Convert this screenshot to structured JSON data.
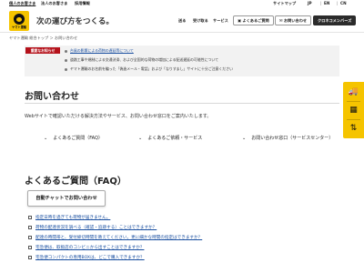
{
  "topbar": {
    "left": [
      "個人のお客さま",
      "法人のお客さま",
      "採用情報"
    ],
    "sitemap": "サイトマップ",
    "languages": [
      "JP",
      "EN",
      "CN"
    ]
  },
  "header": {
    "brand_small": "ヤマト運輸",
    "tagline": "次の運び方をつくる。",
    "nav": [
      "送る",
      "受け取る",
      "サービス"
    ],
    "faq_button": "よくあるご質問",
    "contact_button": "お問い合わせ",
    "member_button": "クロネコメンバーズ"
  },
  "breadcrumb": "ヤマト運輸 総合トップ ＞ お問い合わせ",
  "alert": {
    "badge": "重要なお知らせ",
    "items": [
      {
        "text": "台風の影響による荷物の遅延等について",
        "link": true
      },
      {
        "text": "道路工事や規制による交通渋滞、および全国的な荷物の増加による配送遅延の可能性について",
        "link": false
      },
      {
        "text": "ヤマト運輸のお名前を騙った「偽造メール・電話」および「なりすまし」サイトに十分ご注意ください",
        "link": false
      }
    ]
  },
  "page_title": "お問い合わせ",
  "lead": "Webサイトで確認いただける解決方法やサービス、お問い合わせ窓口をご案内いたします。",
  "anchors": [
    "よくあるご質問（FAQ）",
    "よくあるご依頼・サービス",
    "お問い合わせ窓口（サービスセンター）"
  ],
  "faq": {
    "title": "よくあるご質問（FAQ）",
    "chat_button": "自動チャットでお問い合わせ",
    "items": [
      "指定日時を過ぎても荷物が届きません。",
      "荷物の配達状況を調べる（確認・追跡する）ことはできますか？",
      "配達の時間帯と、受付締切時間を教えてください。更に細かな時間の指定はできますか？",
      "宅急便は、取扱店のコンビニから出すことはできますか？",
      "宅急便コンパクトの専用BOXは、どこで購入できますか？"
    ]
  },
  "side_icons": [
    "truck-icon",
    "calendar-icon",
    "arrows-icon"
  ],
  "colors": {
    "brand_yellow": "#f5c400",
    "alert_red": "#b5121b",
    "link_blue": "#1a4fa0",
    "member_button_bg": "#2b2b2b"
  }
}
